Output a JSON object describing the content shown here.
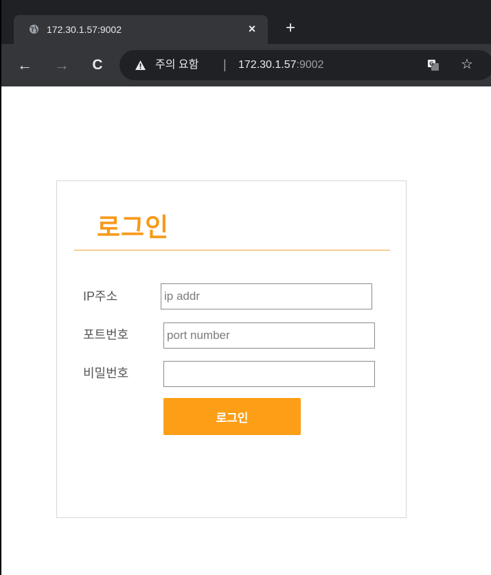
{
  "browser": {
    "tab_title": "172.30.1.57:9002",
    "tab_close": "×",
    "new_tab": "+",
    "back": "←",
    "forward": "→",
    "reload": "C",
    "security_warning": "주의 요함",
    "separator": "|",
    "url_host": "172.30.1.57",
    "url_port": ":9002",
    "bookmark_star": "☆"
  },
  "login": {
    "title": "로그인",
    "fields": {
      "ip": {
        "label": "IP주소",
        "placeholder": "ip addr",
        "value": ""
      },
      "port": {
        "label": "포트번호",
        "placeholder": "port number",
        "value": ""
      },
      "password": {
        "label": "비밀번호",
        "placeholder": "",
        "value": ""
      }
    },
    "submit_label": "로그인"
  },
  "colors": {
    "accent": "#fc9f16",
    "chrome_dark": "#202124",
    "chrome_toolbar": "#35363a"
  }
}
